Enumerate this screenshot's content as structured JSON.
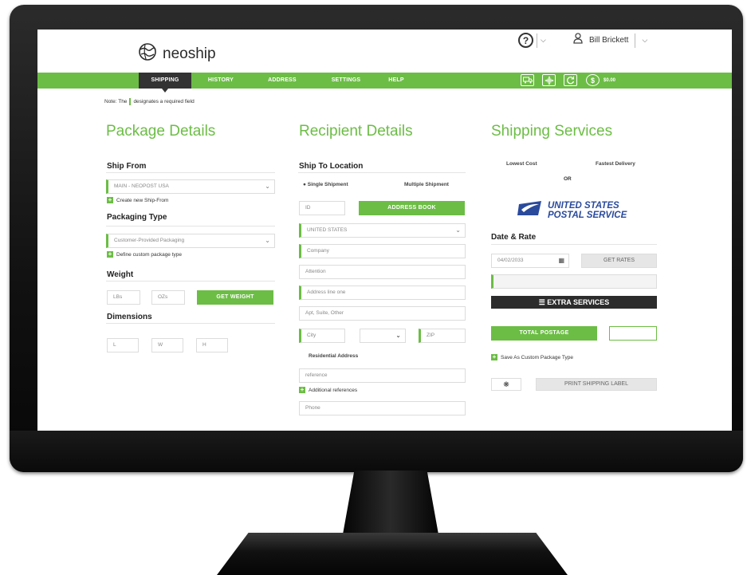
{
  "header": {
    "logo_text": "neoship",
    "help_icon": "question-circle-icon",
    "user_name": "Bill Brickett",
    "user_icon": "user-icon"
  },
  "nav": {
    "items": [
      {
        "label": "SHIPPING",
        "active": true
      },
      {
        "label": "HISTORY"
      },
      {
        "label": "ADDRESS BOOK"
      },
      {
        "label": "SETTINGS"
      },
      {
        "label": "HELP"
      }
    ],
    "icons": [
      "truck-icon",
      "move-icon",
      "refresh-icon",
      "dollar-icon"
    ],
    "balance": "$0.00",
    "active_color": "#333333",
    "brand_color": "#6cbd45"
  },
  "note": {
    "prefix": "Note: The",
    "suffix": "designates a required field"
  },
  "package": {
    "title": "Package Details",
    "ship_from_heading": "Ship From",
    "ship_from_value": "MAIN - NEOPOST USA",
    "create_ship_from": "Create new Ship-From",
    "packaging_heading": "Packaging Type",
    "packaging_value": "Customer-Provided Packaging",
    "define_custom": "Define custom package type",
    "weight_heading": "Weight",
    "lbs_placeholder": "LBs",
    "ozs_placeholder": "OZs",
    "get_weight": "GET WEIGHT",
    "dimensions_heading": "Dimensions",
    "l_placeholder": "L",
    "w_placeholder": "W",
    "h_placeholder": "H"
  },
  "recipient": {
    "title": "Recipient Details",
    "ship_to_heading": "Ship To Location",
    "single_shipment": "Single Shipment",
    "multiple_shipment": "Multiple Shipment",
    "id_placeholder": "ID",
    "address_book_btn": "ADDRESS BOOK",
    "country": "UNITED STATES",
    "company_placeholder": "Company",
    "attention_placeholder": "Attention",
    "address1_placeholder": "Address line one",
    "address2_placeholder": "Apt, Suite, Other",
    "city_placeholder": "City",
    "zip_placeholder": "ZIP",
    "residential": "Residential Address",
    "references_placeholder": "reference",
    "additional_refs": "Additional references",
    "phone_placeholder": "Phone"
  },
  "services": {
    "title": "Shipping Services",
    "lowest_cost": "Lowest Cost",
    "fastest_delivery": "Fastest Delivery",
    "or_text": "OR",
    "usps_line1": "UNITED STATES",
    "usps_line2": "POSTAL SERVICE",
    "date_rate_heading": "Date & Rate",
    "date_value": "04/02/2033",
    "get_rates": "GET RATES",
    "extra_services": "EXTRA SERVICES",
    "total_postage": "TOTAL POSTAGE",
    "save_custom": "Save As Custom Package Type",
    "print_label": "PRINT SHIPPING LABEL",
    "settings_icon": "gear-icon"
  }
}
